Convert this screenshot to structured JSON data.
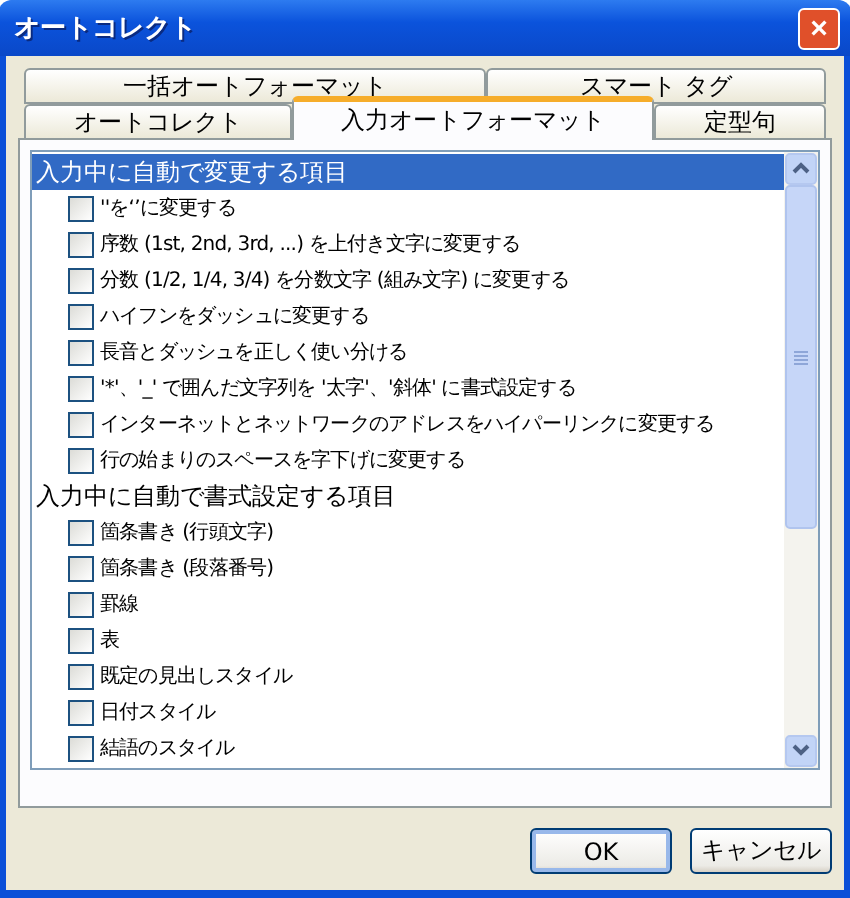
{
  "window": {
    "title": "オートコレクト",
    "close": "×"
  },
  "tab_rows": [
    [
      {
        "label": "一括オートフォーマット",
        "selected": false
      },
      {
        "label": "スマート タグ",
        "selected": false
      }
    ],
    [
      {
        "label": "オートコレクト",
        "selected": false
      },
      {
        "label": "入力オートフォーマット",
        "selected": true
      },
      {
        "label": "定型句",
        "selected": false
      }
    ]
  ],
  "groups": [
    {
      "header": "入力中に自動で変更する項目",
      "selected": true,
      "items": [
        {
          "label": "''を‘’に変更する",
          "checked": false
        },
        {
          "label": "序数 (1st, 2nd, 3rd, ...) を上付き文字に変更する",
          "checked": false
        },
        {
          "label": "分数 (1/2, 1/4, 3/4) を分数文字 (組み文字) に変更する",
          "checked": false
        },
        {
          "label": "ハイフンをダッシュに変更する",
          "checked": false
        },
        {
          "label": "長音とダッシュを正しく使い分ける",
          "checked": false
        },
        {
          "label": "'*'、'_' で囲んだ文字列を '太字'、'斜体' に書式設定する",
          "checked": false
        },
        {
          "label": "インターネットとネットワークのアドレスをハイパーリンクに変更する",
          "checked": false
        },
        {
          "label": "行の始まりのスペースを字下げに変更する",
          "checked": false
        }
      ]
    },
    {
      "header": "入力中に自動で書式設定する項目",
      "selected": false,
      "items": [
        {
          "label": "箇条書き (行頭文字)",
          "checked": false
        },
        {
          "label": "箇条書き (段落番号)",
          "checked": false
        },
        {
          "label": "罫線",
          "checked": false
        },
        {
          "label": "表",
          "checked": false
        },
        {
          "label": "既定の見出しスタイル",
          "checked": false
        },
        {
          "label": "日付スタイル",
          "checked": false
        },
        {
          "label": "結語のスタイル",
          "checked": false
        }
      ]
    }
  ],
  "buttons": [
    {
      "label": "OK",
      "default": true
    },
    {
      "label": "キャンセル",
      "default": false
    }
  ]
}
